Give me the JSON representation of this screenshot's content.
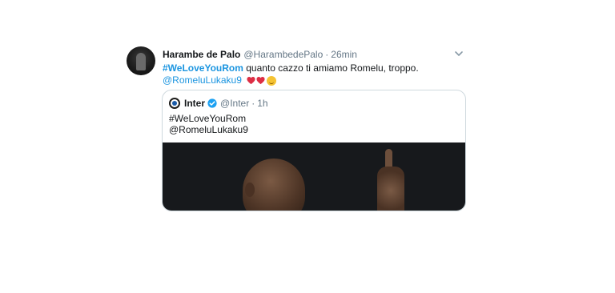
{
  "tweet": {
    "name": "Harambe de Palo",
    "handle": "@HarambedePalo",
    "separator": "·",
    "time": "26min",
    "hashtag": "#WeLoveYouRom",
    "text": "quanto cazzo ti amiamo Romelu, troppo.",
    "mention": "@RomeluLukaku9"
  },
  "quoted_tweet": {
    "name": "Inter",
    "handle": "@Inter",
    "separator": "·",
    "time": "1h",
    "line1": "#WeLoveYouRom",
    "line2": "@RomeluLukaku9"
  },
  "icons": {
    "menu": "chevron-down-icon",
    "verified": "verified-badge-icon",
    "emoji": [
      "red-heart-icon",
      "red-heart-icon",
      "smiling-face-with-hearts-icon"
    ]
  },
  "colors": {
    "link": "#1b95e0",
    "text": "#14171a",
    "muted": "#657786",
    "heart": "#dd2e44"
  }
}
